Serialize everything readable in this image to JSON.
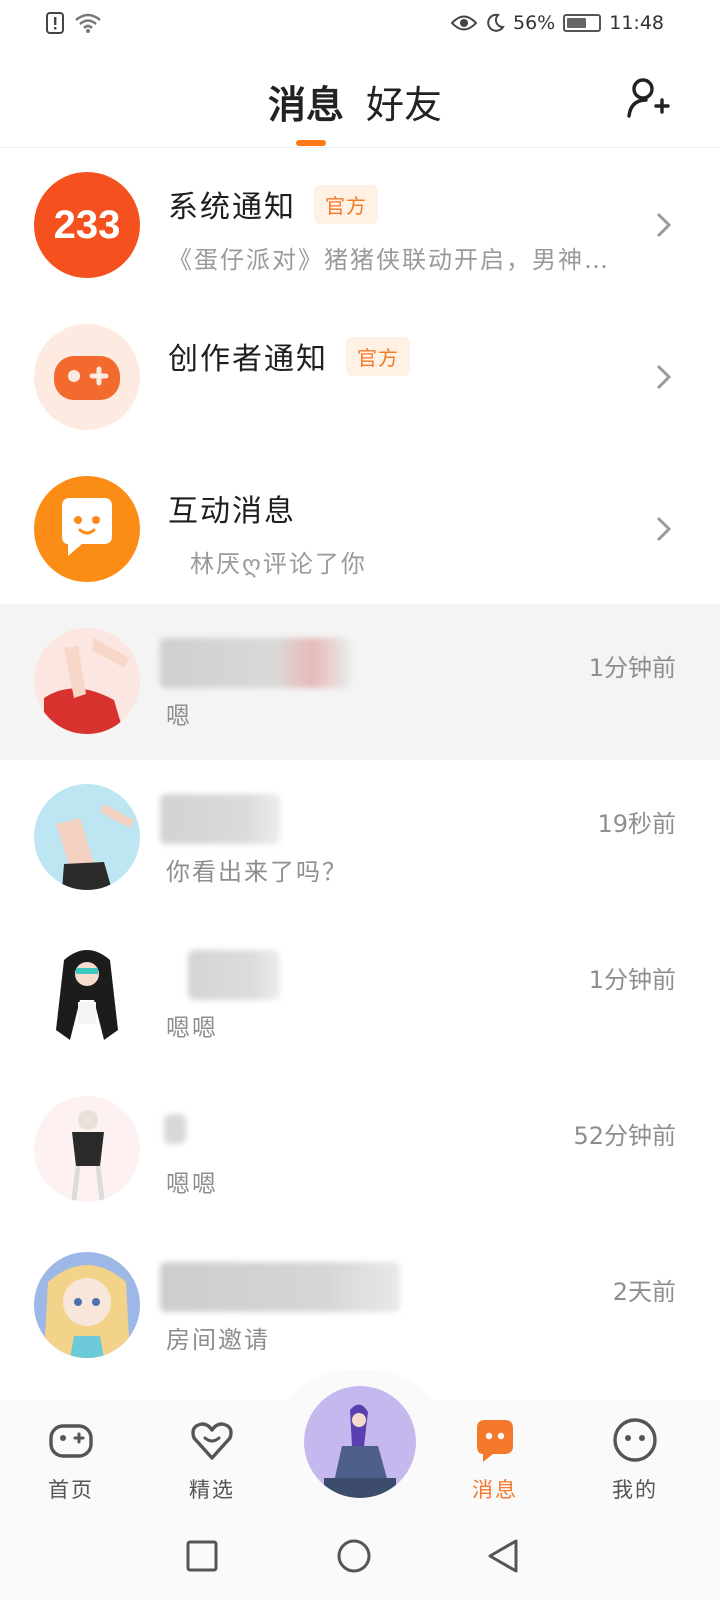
{
  "status_bar": {
    "battery_percent": "56%",
    "battery_level": 0.56,
    "time": "11:48"
  },
  "header": {
    "tab_messages": "消息",
    "tab_friends": "好友"
  },
  "notifications": [
    {
      "title": "系统通知",
      "badge": "官方",
      "subtitle": "《蛋仔派对》猪猪侠联动开启，男神…",
      "logo_text": "233"
    },
    {
      "title": "创作者通知",
      "badge": "官方",
      "subtitle": ""
    },
    {
      "title": "互动消息",
      "badge": "",
      "subtitle": "林厌ღ评论了你"
    }
  ],
  "chats": [
    {
      "time": "1分钟前",
      "message": "嗯"
    },
    {
      "time": "19秒前",
      "message": "你看出来了吗？"
    },
    {
      "time": "1分钟前",
      "message": "嗯嗯"
    },
    {
      "time": "52分钟前",
      "message": "嗯嗯"
    },
    {
      "time": "2天前",
      "message": "房间邀请"
    }
  ],
  "bottom_nav": {
    "home": "首页",
    "featured": "精选",
    "messages": "消息",
    "mine": "我的"
  },
  "colors": {
    "accent": "#f5792a",
    "badge_bg": "#fff1e3"
  }
}
